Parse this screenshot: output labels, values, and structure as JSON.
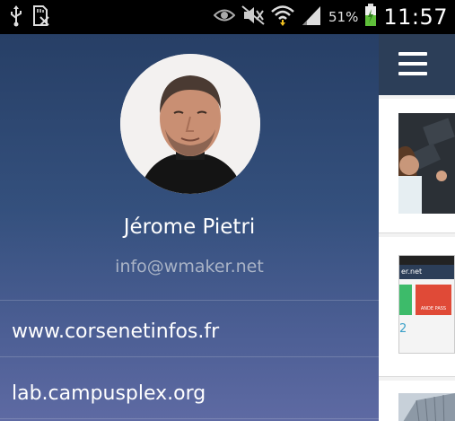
{
  "status_bar": {
    "battery_percent": "51%",
    "time": "11:57",
    "icons": [
      "usb-icon",
      "sd-card-icon",
      "eye-icon",
      "mute-icon",
      "wifi-icon",
      "signal-icon",
      "battery-charging-icon"
    ]
  },
  "drawer": {
    "profile_name": "Jérome Pietri",
    "profile_email": "info@wmaker.net",
    "links": [
      "www.corsenetinfos.fr",
      "lab.campusplex.org"
    ]
  },
  "app": {
    "menu_icon": "hamburger-menu-icon",
    "card2_thumb_text": "er.net",
    "card2_thumb_red": "ANDE PASS",
    "card2_thumb_num": "2"
  },
  "colors": {
    "drawer_top": "#273f66",
    "drawer_bottom": "#5e6aa3",
    "app_bar": "#2c3e58",
    "status_bar": "#000000"
  }
}
